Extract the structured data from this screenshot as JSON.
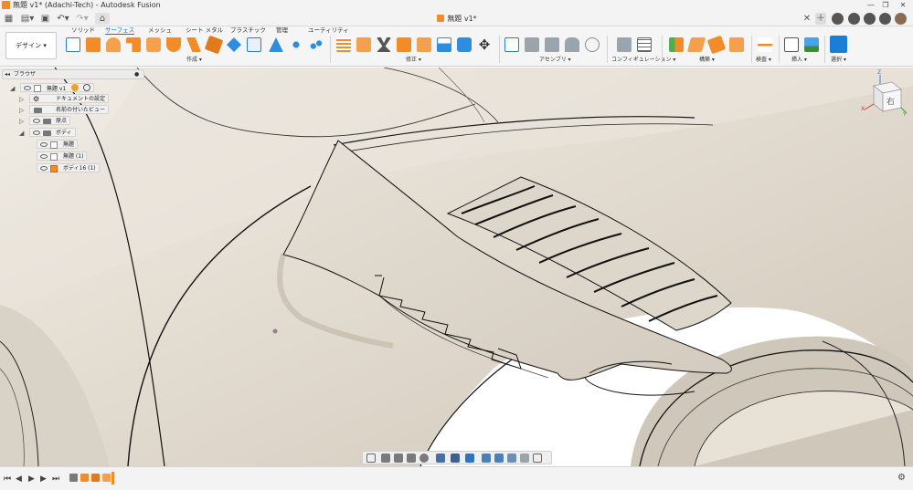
{
  "window": {
    "title": "無題 v1* (Adachi-Tech) - Autodesk Fusion",
    "controls": [
      "—",
      "❐",
      "✕"
    ]
  },
  "quick_access": {
    "grid_icon": "grid-icon",
    "file_icon": "file-icon",
    "save_icon": "save-icon",
    "undo_icon": "undo-icon",
    "redo_icon": "redo-icon",
    "home_icon": "home-icon",
    "doc_tab_label": "無題 v1*",
    "right_icons": [
      "close-tab-icon",
      "new-tab-icon",
      "extensions-icon",
      "job-status-icon",
      "notifications-icon",
      "help-icon",
      "avatar"
    ]
  },
  "ribbon": {
    "workspace_button": "デザイン ▾",
    "tabs": [
      "ソリッド",
      "サーフェス",
      "メッシュ",
      "シート メタル",
      "プラスチック",
      "管理",
      "ユーティリティ"
    ],
    "active_tab": "サーフェス",
    "groups": {
      "create": "作成 ▾",
      "modify": "修正 ▾",
      "assemble": "アセンブリ ▾",
      "configure": "コンフィギュレーション ▾",
      "construct": "構築 ▾",
      "inspect": "検査 ▾",
      "insert": "挿入 ▾",
      "select": "選択 ▾"
    }
  },
  "browser": {
    "header": "ブラウザ",
    "root": "無題 v1",
    "items": [
      {
        "label": "ドキュメントの設定"
      },
      {
        "label": "名前の付いたビュー"
      },
      {
        "label": "原点"
      },
      {
        "label": "ボディ"
      },
      {
        "label": "無題"
      },
      {
        "label": "無題 (1)"
      },
      {
        "label": "ボディ16 (1)"
      }
    ]
  },
  "viewcube": {
    "face_label": "右",
    "axes": [
      "Z",
      "X",
      "Y"
    ]
  },
  "colors": {
    "accent": "#1a6fc9",
    "surface_tool": "#f28c28",
    "model": "#d8d0c3"
  }
}
